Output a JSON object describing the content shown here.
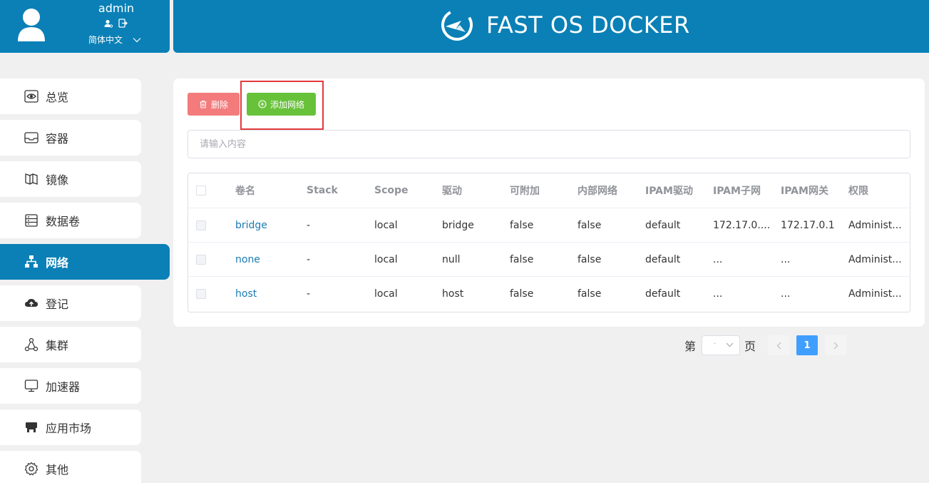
{
  "user": {
    "name": "admin",
    "language": "简体中文"
  },
  "brand": {
    "title": "FAST OS DOCKER"
  },
  "sidebar": {
    "items": [
      {
        "label": "总览",
        "icon": "eye-icon"
      },
      {
        "label": "容器",
        "icon": "inbox-icon"
      },
      {
        "label": "镜像",
        "icon": "image-icon"
      },
      {
        "label": "数据卷",
        "icon": "database-icon"
      },
      {
        "label": "网络",
        "icon": "network-icon",
        "active": true
      },
      {
        "label": "登记",
        "icon": "cloud-upload-icon"
      },
      {
        "label": "集群",
        "icon": "cluster-icon"
      },
      {
        "label": "加速器",
        "icon": "monitor-icon"
      },
      {
        "label": "应用市场",
        "icon": "store-icon"
      },
      {
        "label": "其他",
        "icon": "gear-icon"
      }
    ]
  },
  "toolbar": {
    "delete_label": "删除",
    "add_label": "添加网络"
  },
  "search": {
    "placeholder": "请输入内容"
  },
  "table": {
    "columns": [
      "卷名",
      "Stack",
      "Scope",
      "驱动",
      "可附加",
      "内部网络",
      "IPAM驱动",
      "IPAM子网",
      "IPAM网关",
      "权限"
    ],
    "rows": [
      [
        "bridge",
        "-",
        "local",
        "bridge",
        "false",
        "false",
        "default",
        "172.17.0....",
        "172.17.0.1",
        "Administ..."
      ],
      [
        "none",
        "-",
        "local",
        "null",
        "false",
        "false",
        "default",
        "...",
        "...",
        "Administ..."
      ],
      [
        "host",
        "-",
        "local",
        "host",
        "false",
        "false",
        "default",
        "...",
        "...",
        "Administ..."
      ]
    ]
  },
  "pagination": {
    "prefix": "第",
    "suffix": "页",
    "current_page": "1",
    "select_value": "·"
  },
  "colors": {
    "primary": "#0a80b6",
    "delete": "#f37b7c",
    "add": "#67c23a",
    "page_active": "#409eff",
    "highlight": "#e4393c"
  }
}
